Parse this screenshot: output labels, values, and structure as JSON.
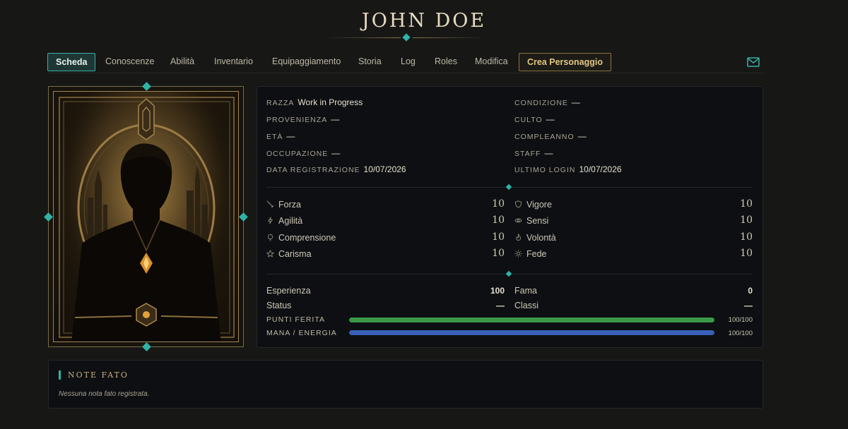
{
  "header": {
    "title": "JOHN DOE"
  },
  "tabs": [
    {
      "label": "Scheda",
      "active": true
    },
    {
      "label": "Conoscenze"
    },
    {
      "label": "Abilità"
    },
    {
      "label": "Inventario"
    },
    {
      "label": "Equipaggiamento"
    },
    {
      "label": "Storia"
    },
    {
      "label": "Log"
    },
    {
      "label": "Roles"
    },
    {
      "label": "Modifica"
    },
    {
      "label": "Crea Personaggio",
      "highlight": true
    }
  ],
  "header_icons": {
    "mail": "mail-icon"
  },
  "info": {
    "left": [
      {
        "label": "Razza",
        "value": "Work in Progress"
      },
      {
        "label": "Provenienza",
        "value": "—"
      },
      {
        "label": "Età",
        "value": "—"
      },
      {
        "label": "Occupazione",
        "value": "—"
      },
      {
        "label": "Data registrazione",
        "value": "10/07/2026"
      }
    ],
    "right": [
      {
        "label": "Condizione",
        "value": "—"
      },
      {
        "label": "Culto",
        "value": "—"
      },
      {
        "label": "Compleanno",
        "value": "—"
      },
      {
        "label": "Staff",
        "value": "—"
      },
      {
        "label": "Ultimo login",
        "value": "10/07/2026"
      }
    ]
  },
  "attributes": {
    "left": [
      {
        "label": "Forza",
        "value": "10",
        "icon": "sword-icon"
      },
      {
        "label": "Agilità",
        "value": "10",
        "icon": "bolt-icon"
      },
      {
        "label": "Comprensione",
        "value": "10",
        "icon": "bulb-icon"
      },
      {
        "label": "Carisma",
        "value": "10",
        "icon": "star-icon"
      }
    ],
    "right": [
      {
        "label": "Vigore",
        "value": "10",
        "icon": "shield-icon"
      },
      {
        "label": "Sensi",
        "value": "10",
        "icon": "eye-icon"
      },
      {
        "label": "Volontà",
        "value": "10",
        "icon": "flame-icon"
      },
      {
        "label": "Fede",
        "value": "10",
        "icon": "sun-icon"
      }
    ]
  },
  "misc": {
    "esperienza_label": "Esperienza",
    "esperienza_value": "100",
    "fama_label": "Fama",
    "fama_value": "0",
    "status_label": "Status",
    "status_value": "—",
    "classi_label": "Classi",
    "classi_value": "—"
  },
  "bars": [
    {
      "label": "PUNTI FERITA",
      "text": "100/100",
      "fraction": 1.0,
      "color": "#3a9a48"
    },
    {
      "label": "MANA / ENERGIA",
      "text": "100/100",
      "fraction": 1.0,
      "color": "#3a5fb8"
    }
  ],
  "notes": {
    "title": "NOTE FATO",
    "text": "Nessuna nota fato registrata."
  },
  "colors": {
    "accent": "#2fb3a6",
    "gold": "#c9b27e",
    "hp": "#3a9a48",
    "mana": "#3a5fb8"
  }
}
